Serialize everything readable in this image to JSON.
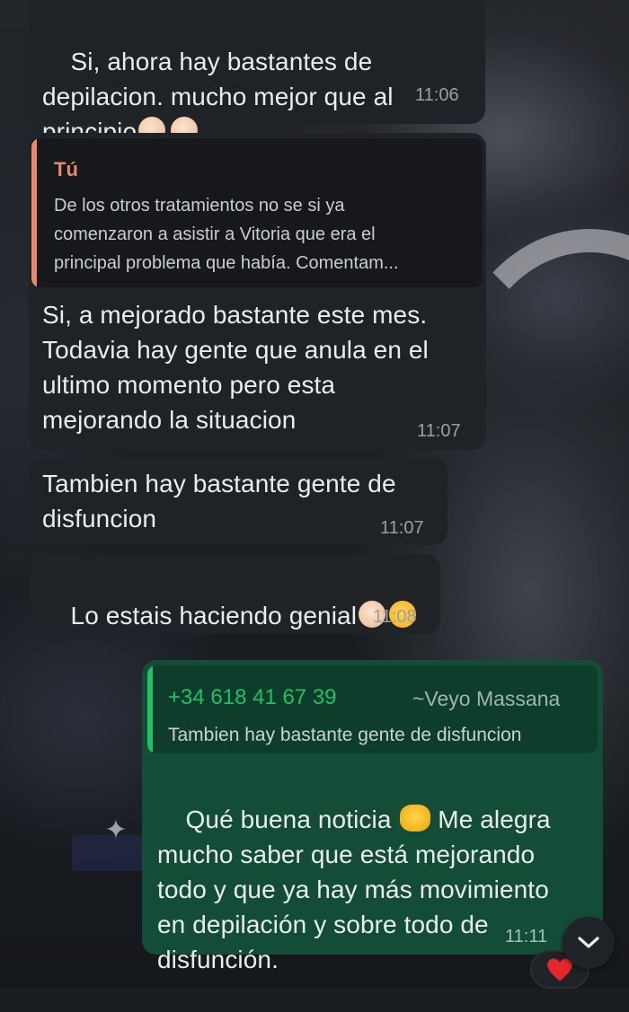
{
  "messages": [
    {
      "direction": "incoming",
      "text": "Si, ahora hay bastantes de\ndepilacion. mucho mejor que al\nprincipio",
      "emoji": [
        "clapping-hands",
        "clapping-hands"
      ],
      "time": "11:06"
    },
    {
      "direction": "incoming",
      "quote": {
        "author": "Tú",
        "text_lines": [
          "De los otros tratamientos no se si ya",
          "comenzaron a asistir a Vitoria que era el",
          "principal problema que había. Comentam..."
        ]
      },
      "text": "Si, a mejorado bastante este mes.\nTodavia hay gente que anula en el\nultimo momento pero esta\nmejorando la situacion",
      "time": "11:07"
    },
    {
      "direction": "incoming",
      "text": "Tambien hay bastante gente de\ndisfuncion",
      "time": "11:07"
    },
    {
      "direction": "incoming",
      "text": "Lo estais haciendo genial",
      "emoji": [
        "clapping-hands",
        "partying-face"
      ],
      "time": "11:08"
    },
    {
      "direction": "outgoing",
      "quote": {
        "phone": "+34 618 41 67 39",
        "name": "~Veyo Massana",
        "text": "Tambien hay bastante gente de disfuncion"
      },
      "text_before_emoji": "Qué buena noticia ",
      "emoji": [
        "raising-hands"
      ],
      "text_after_emoji": " Me alegra",
      "text_rest": "mucho saber que está mejorando\ntodo y que ya hay más movimiento\nen depilación y sobre todo de\ndisfunción.",
      "time": "11:11",
      "reaction": "heart"
    }
  ],
  "colors": {
    "incoming_bubble": "#1f2226",
    "outgoing_bubble": "#144d37",
    "quote_author_in": "#e9876c",
    "quote_phone_out": "#21c063",
    "text": "#e9edef"
  },
  "icons": {
    "scroll_down": "chevron-down-icon",
    "reaction": "red-heart-icon"
  }
}
